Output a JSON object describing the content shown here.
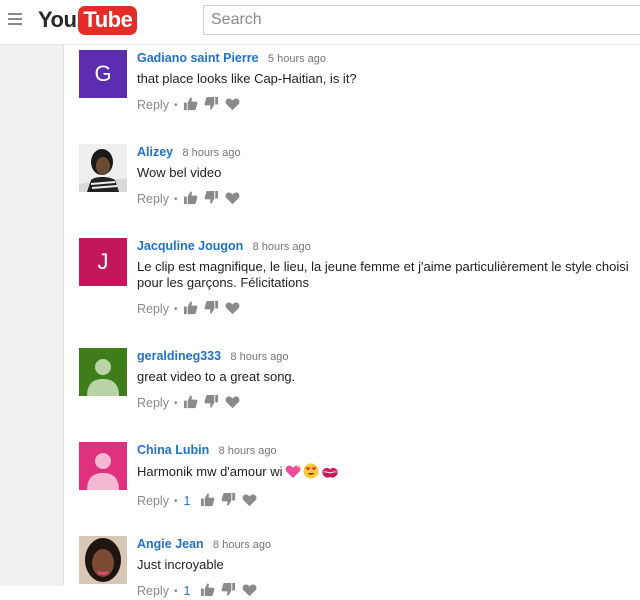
{
  "header": {
    "logo_you": "You",
    "logo_tube": "Tube",
    "search_placeholder": "Search"
  },
  "colors": {
    "author_blue": "#1f72c6",
    "youtube_red": "#e52d27",
    "action_gray": "#8a8a8a"
  },
  "comments": [
    {
      "author": "Gadiano saint Pierre",
      "time": "5 hours ago",
      "text": "that place looks like Cap-Haitian, is it?",
      "reply_label": "Reply",
      "avatar": {
        "type": "letter",
        "letter": "G",
        "color": "#5c2db0"
      }
    },
    {
      "author": "Alizey",
      "time": "8 hours ago",
      "text": "Wow bel video",
      "reply_label": "Reply",
      "avatar": {
        "type": "photo",
        "icon": "woman-photo-icon"
      }
    },
    {
      "author": "Jacquline Jougon",
      "time": "8 hours ago",
      "text": "Le clip est magnifique,  le lieu,  la jeune femme et j'aime particulièrement le style choisi pour les garçons.  Félicitations",
      "reply_label": "Reply",
      "avatar": {
        "type": "letter",
        "letter": "J",
        "color": "#c2185b"
      }
    },
    {
      "author": "geraldineg333",
      "time": "8 hours ago",
      "text": "great video  to a great song.",
      "reply_label": "Reply",
      "avatar": {
        "type": "silhouette",
        "color": "#3e7d1a"
      }
    },
    {
      "author": "China Lubin",
      "time": "8 hours ago",
      "text": "Harmonik mw d'amour wi",
      "reply_label": "Reply",
      "reply_count": "1",
      "emoji_icons": [
        "sparkling-heart-icon",
        "heart-eyes-icon",
        "kiss-mark-icon"
      ],
      "avatar": {
        "type": "silhouette",
        "color": "#e0317f"
      }
    },
    {
      "author": "Angie Jean",
      "time": "8 hours ago",
      "text": "Just incroyable",
      "reply_label": "Reply",
      "reply_count": "1",
      "avatar": {
        "type": "photo",
        "icon": "woman-photo-icon"
      }
    }
  ]
}
